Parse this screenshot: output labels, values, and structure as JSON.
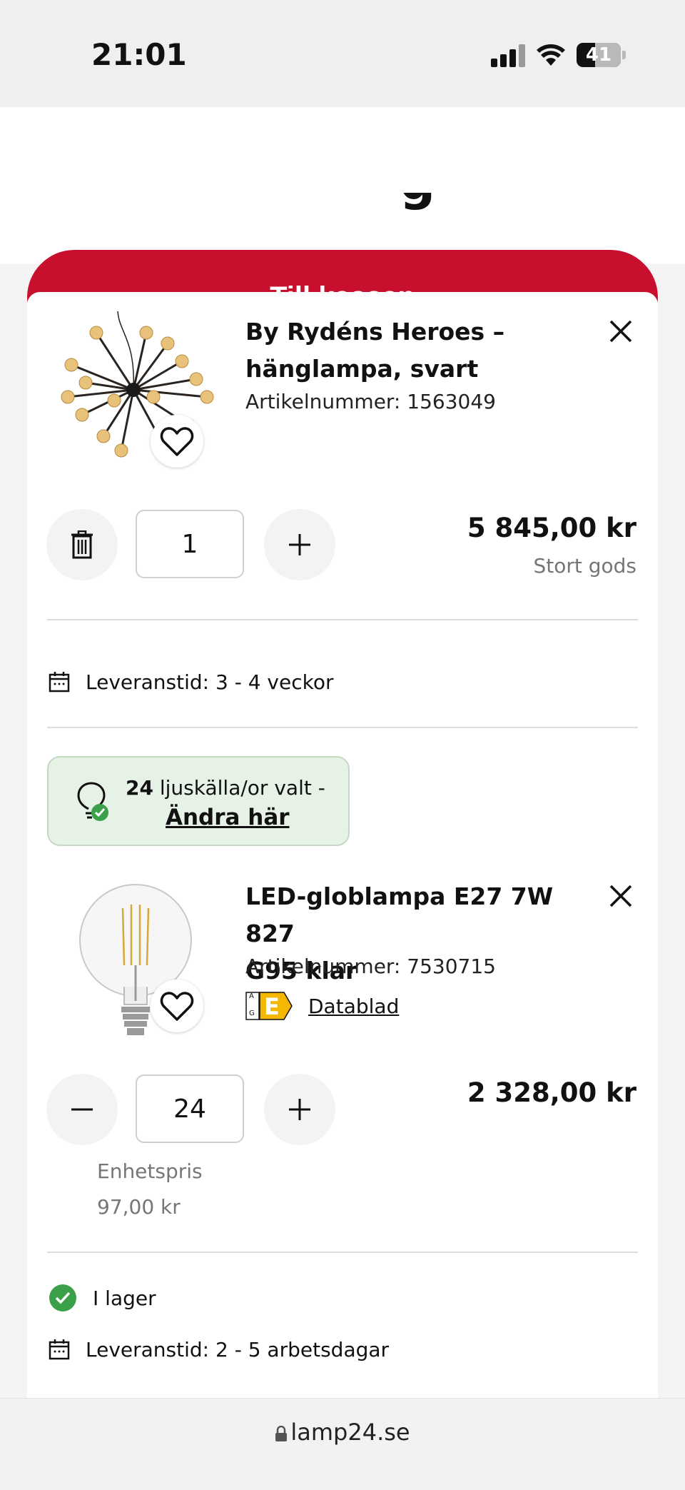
{
  "status_bar": {
    "time": "21:01",
    "battery": "41"
  },
  "header": {
    "clipped_heading": "g",
    "checkout_label": "Till kassan"
  },
  "cart": {
    "items": [
      {
        "title_line1": "By Rydéns Heroes –",
        "title_line2": "hänglampa, svart",
        "article": "Artikelnummer: 1563049",
        "quantity": "1",
        "price": "5 845,00 kr",
        "shipping_note": "Stort gods",
        "delivery": "Leveranstid: 3 - 4 veckor",
        "icons": [
          "trash-icon",
          "plus-icon",
          "close-icon",
          "heart-icon",
          "calendar-icon"
        ]
      },
      {
        "title_line1": "LED-globlampa E27 7W 827",
        "title_line2": "G95 klar",
        "article": "Artikelnummer: 7530715",
        "energy_class": "E",
        "energy_scale_top": "A",
        "energy_scale_bottom": "G",
        "datasheet": "Datablad",
        "quantity": "24",
        "price": "2 328,00 kr",
        "unit_price_label": "Enhetspris",
        "unit_price": "97,00 kr",
        "stock": "I lager",
        "delivery": "Leveranstid: 2 - 5 arbetsdagar",
        "icons": [
          "minus-icon",
          "plus-icon",
          "close-icon",
          "heart-icon",
          "check-circle-icon",
          "calendar-icon"
        ]
      }
    ],
    "light_source_badge": {
      "count": "24",
      "text": " ljuskälla/or valt -",
      "link": "Ändra här"
    }
  },
  "browser": {
    "url": "lamp24.se"
  },
  "colors": {
    "primary": "#c8102e",
    "badge_bg": "#e6f2e5",
    "success": "#3aa14a"
  }
}
